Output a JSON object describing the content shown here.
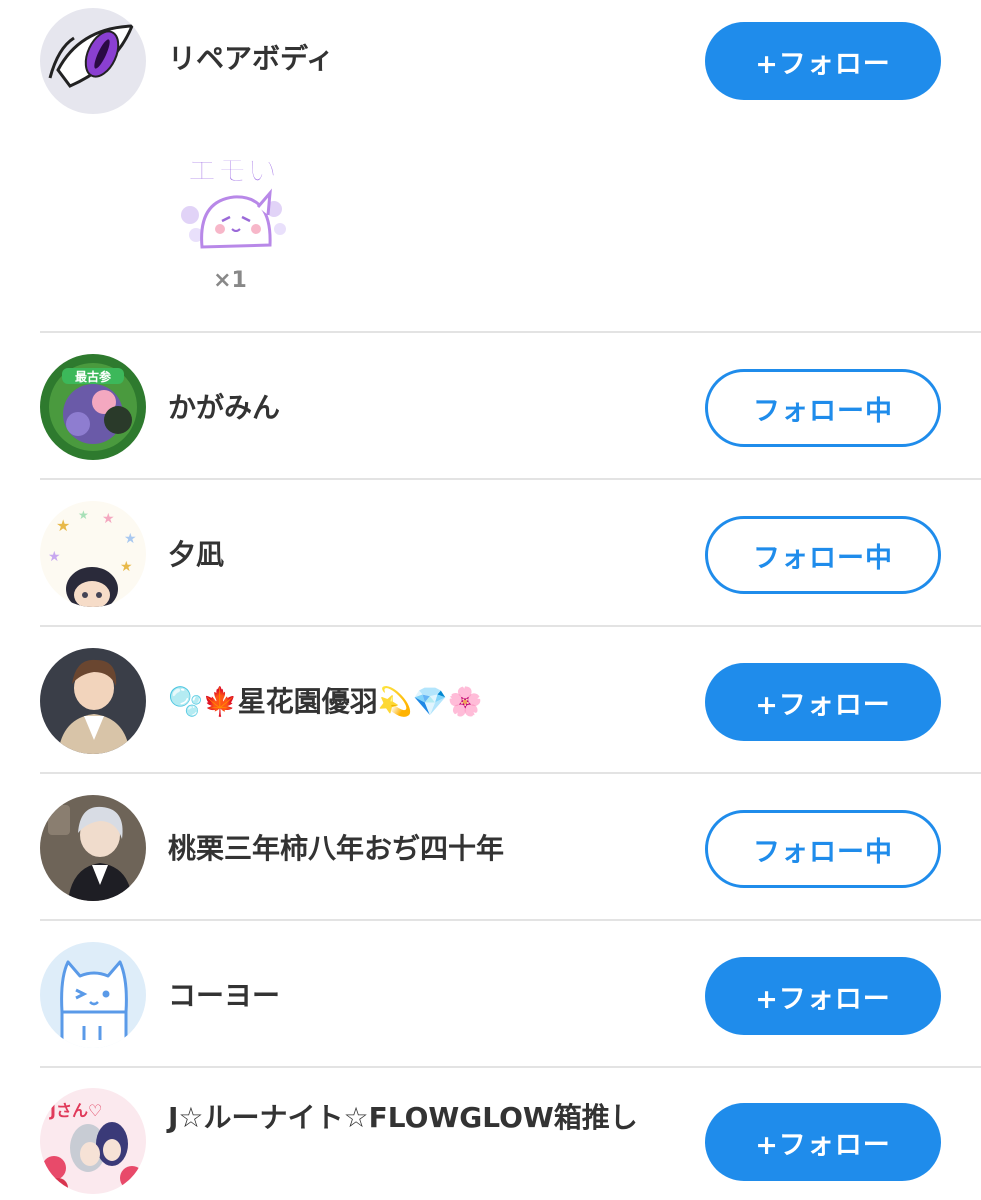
{
  "users": [
    {
      "name": "リペアボディ",
      "button": "+フォロー",
      "state": "follow"
    },
    {
      "name": "かがみん",
      "button": "フォロー中",
      "state": "following"
    },
    {
      "name": "夕凪",
      "button": "フォロー中",
      "state": "following"
    },
    {
      "name": "🫧🍁星花園優羽💫💎🌸",
      "button": "+フォロー",
      "state": "follow"
    },
    {
      "name": "桃栗三年柿八年おぢ四十年",
      "button": "フォロー中",
      "state": "following"
    },
    {
      "name": "コーヨー",
      "button": "+フォロー",
      "state": "follow"
    },
    {
      "name": "J☆ルーナイト☆FLOWGLOW箱推し",
      "button": "+フォロー",
      "state": "follow"
    }
  ],
  "reaction": {
    "stamp_text": "エモい",
    "count": "×1",
    "icon": "emoi-ghost-stamp-icon"
  },
  "colors": {
    "accent": "#1f8ceb",
    "divider": "#e3e3e3",
    "text": "#333333"
  }
}
